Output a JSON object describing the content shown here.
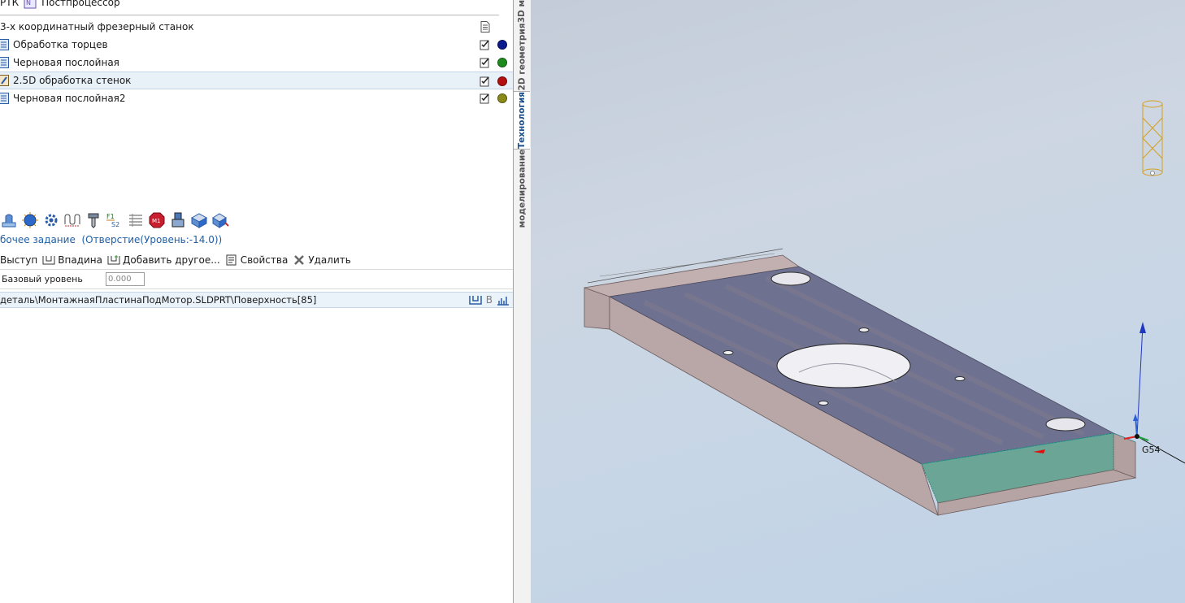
{
  "header": {
    "left_label": "РТК",
    "title": "Постпроцессор"
  },
  "tree": {
    "machine": "3-х координатный фрезерный станок",
    "operations": [
      {
        "label": "Обработка торцев",
        "color": "#0b1a8c",
        "selected": false
      },
      {
        "label": "Черновая послойная",
        "color": "#1e8a1e",
        "selected": false
      },
      {
        "label": "2.5D обработка стенок",
        "color": "#b41010",
        "selected": true
      },
      {
        "label": "Черновая послойная2",
        "color": "#8a8a1a",
        "selected": false
      }
    ]
  },
  "toolbar": {
    "icons": [
      "pocket-icon",
      "sphere-icon",
      "gear-icon",
      "toolpath-icon",
      "tool-holder-icon",
      "f1-s2-icon",
      "list-icon",
      "m1-stop-icon",
      "coolant-icon",
      "stock-icon",
      "stock-process-icon"
    ]
  },
  "work_task": {
    "title": "бочее задание",
    "detail": "(Отверстие(Уровень:-14.0))"
  },
  "actions": {
    "boss": "Выступ",
    "pocket": "Впадина",
    "add_other": "Добавить другое...",
    "properties": "Свойства",
    "delete": "Удалить"
  },
  "params": {
    "base_level_label": "Базовый уровень",
    "base_level_value": "0.000"
  },
  "geometry_path": {
    "text": "деталь\\МонтажнаяПластинаПодМотор.SLDPRT\\Поверхность[85]",
    "b_label": "B"
  },
  "vtabs": {
    "tab_3d": "3D м",
    "tab_2d": "2D геометрия",
    "tab_tech": "Технология",
    "tab_model": "моделирование"
  },
  "viewport": {
    "cs_label": "G54"
  },
  "colors": {
    "accent": "#1f5fa8",
    "plate_top": "#6e7290",
    "plate_side": "#b9a6a6",
    "wall_face": "#6aa595"
  }
}
